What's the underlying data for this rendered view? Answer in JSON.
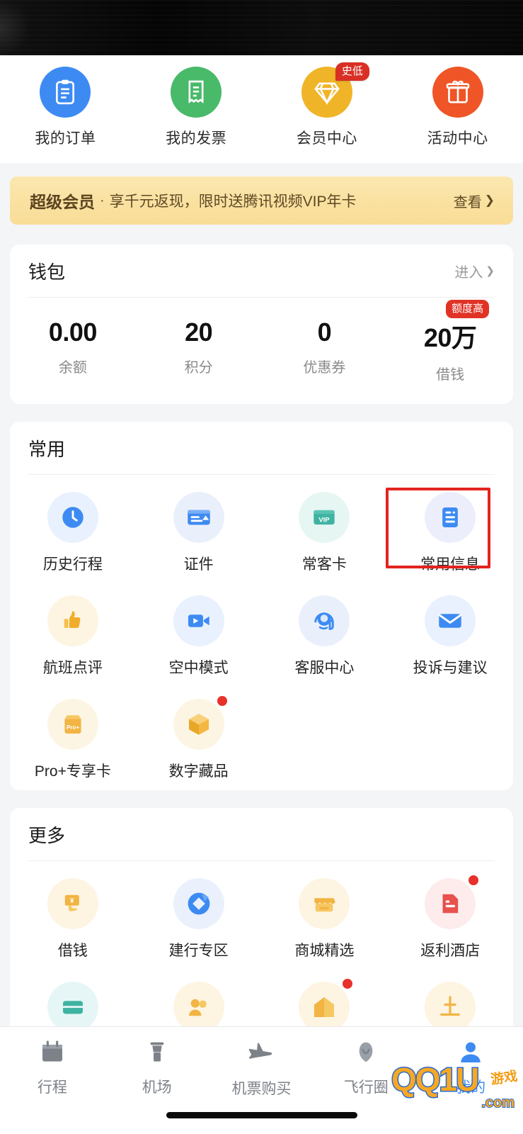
{
  "quick_entries": [
    {
      "label": "我的订单",
      "icon": "clipboard-icon",
      "color": "#3d8bf2",
      "badge": ""
    },
    {
      "label": "我的发票",
      "icon": "receipt-icon",
      "color": "#49b96a",
      "badge": ""
    },
    {
      "label": "会员中心",
      "icon": "diamond-icon",
      "color": "#f0b428",
      "badge": "史低"
    },
    {
      "label": "活动中心",
      "icon": "gift-icon",
      "color": "#ef5526",
      "badge": ""
    }
  ],
  "vip_banner": {
    "strong": "超级会员",
    "separator": "·",
    "text": "享千元返现，限时送腾讯视频VIP年卡",
    "cta": "查看",
    "chevron": "❯"
  },
  "wallet": {
    "title": "钱包",
    "enter": "进入",
    "chevron": "❯",
    "stats": [
      {
        "value": "0.00",
        "label": "余额",
        "badge": ""
      },
      {
        "value": "20",
        "label": "积分",
        "badge": ""
      },
      {
        "value": "0",
        "label": "优惠券",
        "badge": ""
      },
      {
        "value": "20万",
        "label": "借钱",
        "badge": "额度高"
      }
    ]
  },
  "common": {
    "title": "常用",
    "items": [
      {
        "label": "历史行程",
        "icon": "clock-icon",
        "bg": "#e8f1fd",
        "highlight": false,
        "dot": false
      },
      {
        "label": "证件",
        "icon": "id-card-icon",
        "bg": "#eaf0fb",
        "highlight": false,
        "dot": false
      },
      {
        "label": "常客卡",
        "icon": "vip-card-icon",
        "bg": "#e6f6f3",
        "highlight": false,
        "dot": false
      },
      {
        "label": "常用信息",
        "icon": "document-icon",
        "bg": "#eceffb",
        "highlight": true,
        "dot": false
      },
      {
        "label": "航班点评",
        "icon": "thumbs-up-icon",
        "bg": "#fdf4e2",
        "highlight": false,
        "dot": false
      },
      {
        "label": "空中模式",
        "icon": "video-camera-icon",
        "bg": "#e8f1fd",
        "highlight": false,
        "dot": false
      },
      {
        "label": "客服中心",
        "icon": "headset-icon",
        "bg": "#eaf0fb",
        "highlight": false,
        "dot": false
      },
      {
        "label": "投诉与建议",
        "icon": "envelope-icon",
        "bg": "#e8f1fd",
        "highlight": false,
        "dot": false
      },
      {
        "label": "Pro+专享卡",
        "icon": "pro-card-icon",
        "bg": "#fdf5e4",
        "highlight": false,
        "dot": false
      },
      {
        "label": "数字藏品",
        "icon": "cube-icon",
        "bg": "#fdf5e4",
        "highlight": false,
        "dot": true
      }
    ]
  },
  "more": {
    "title": "更多",
    "items": [
      {
        "label": "借钱",
        "icon": "yen-hand-icon",
        "bg": "#fdf4e2",
        "dot": false
      },
      {
        "label": "建行专区",
        "icon": "ccb-logo-icon",
        "bg": "#eaf1fc",
        "dot": false
      },
      {
        "label": "商城精选",
        "icon": "shop-icon",
        "bg": "#fdf4e2",
        "dot": false
      },
      {
        "label": "返利酒店",
        "icon": "hotel-icon",
        "bg": "#fdeceb",
        "dot": true
      }
    ],
    "partial_items": [
      {
        "icon": "card-icon",
        "bg": "#e6f6f6",
        "dot": false
      },
      {
        "icon": "people-icon",
        "bg": "#fdf4e2",
        "dot": false
      },
      {
        "icon": "house-icon",
        "bg": "#fdf4e2",
        "dot": true
      },
      {
        "icon": "tower-icon",
        "bg": "#fdf4e2",
        "dot": false
      }
    ]
  },
  "tabbar": {
    "items": [
      {
        "label": "行程",
        "icon": "calendar-icon",
        "active": false
      },
      {
        "label": "机场",
        "icon": "control-tower-icon",
        "active": false
      },
      {
        "label": "机票购买",
        "icon": "airplane-icon",
        "active": false
      },
      {
        "label": "飞行圈",
        "icon": "feather-icon",
        "active": false
      },
      {
        "label": "我的",
        "icon": "user-icon",
        "active": true
      }
    ]
  },
  "watermark": {
    "main": "QQ1U",
    "suffix": ".com",
    "cn": "游戏"
  },
  "colors": {
    "accent_blue": "#3d8bf2",
    "accent_orange": "#f0a52a",
    "accent_red": "#e3231f",
    "page_bg": "#f4f5f7"
  }
}
